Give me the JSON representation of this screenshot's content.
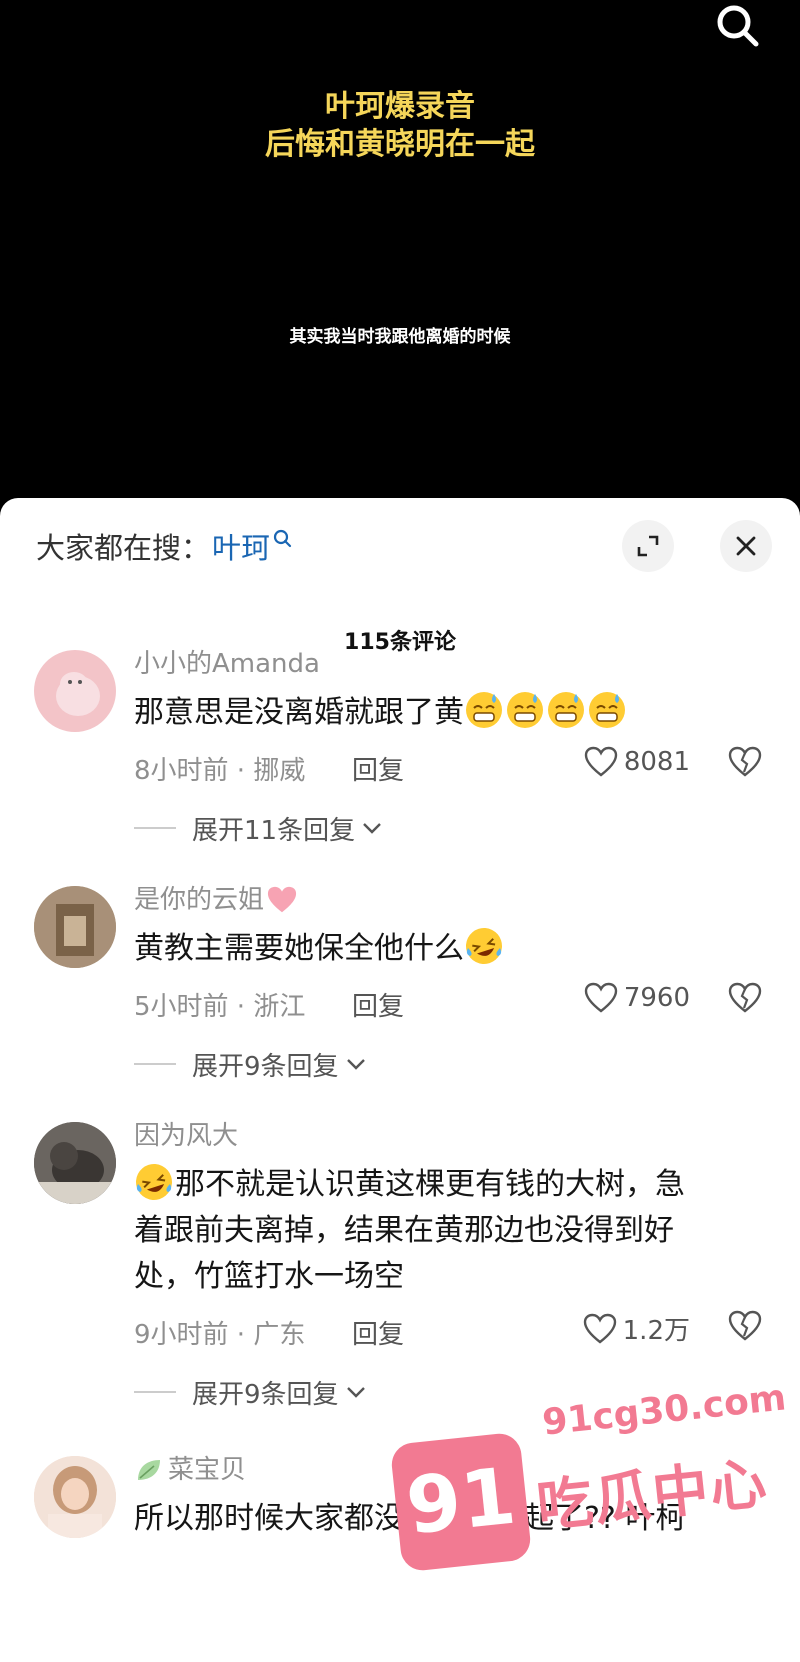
{
  "video": {
    "title_line1": "叶珂爆录音",
    "title_line2": "后悔和黄晓明在一起",
    "subtitle": "其实我当时我跟他离婚的时候",
    "title_color": "#f5d65a"
  },
  "search_bar": {
    "prefix": "大家都在搜：",
    "keyword": "叶珂",
    "keyword_color": "#1a66b3"
  },
  "comment_count": "115条评论",
  "comments": [
    {
      "username": "小小的Amanda",
      "text": "那意思是没离婚就跟了黄",
      "emoji": [
        "grimacing-sweat-emoji",
        "grimacing-sweat-emoji",
        "grimacing-sweat-emoji",
        "grimacing-sweat-emoji"
      ],
      "time_location": "8小时前 · 挪威",
      "reply_label": "回复",
      "likes": "8081",
      "expand_label": "展开11条回复"
    },
    {
      "username": "是你的云姐",
      "username_suffix_icon": "pink-heart-icon",
      "text": "黄教主需要她保全他什么",
      "emoji": [
        "laughing-tears-emoji"
      ],
      "time_location": "5小时前 · 浙江",
      "reply_label": "回复",
      "likes": "7960",
      "expand_label": "展开9条回复"
    },
    {
      "username": "因为风大",
      "text_line1": "那不就是认识黄这棵更有钱的大树，急",
      "text_line2": "着跟前夫离掉，结果在黄那边也没得到好",
      "text_line3": "处，竹篮打水一场空",
      "emoji": [
        "laughing-tears-emoji"
      ],
      "time_location": "9小时前 · 广东",
      "reply_label": "回复",
      "likes": "1.2万",
      "expand_label": "展开9条回复"
    },
    {
      "username": "菜宝贝",
      "username_prefix_icon": "leaf-icon",
      "text": "所以那时候大家都没离婚撞一起了?? 叶柯"
    }
  ],
  "watermark": {
    "domain": "91cg30.com",
    "badge": "91",
    "text": "吃瓜中心",
    "color": "#f27a92"
  }
}
